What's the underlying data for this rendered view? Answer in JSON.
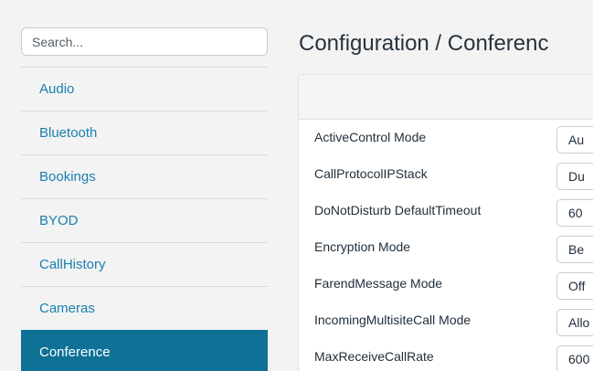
{
  "search": {
    "placeholder": "Search..."
  },
  "sidebar": {
    "items": [
      {
        "label": "Audio"
      },
      {
        "label": "Bluetooth"
      },
      {
        "label": "Bookings"
      },
      {
        "label": "BYOD"
      },
      {
        "label": "CallHistory"
      },
      {
        "label": "Cameras"
      },
      {
        "label": "Conference",
        "active": true
      }
    ]
  },
  "page": {
    "title": "Configuration / Conferenc"
  },
  "settings": [
    {
      "label": "ActiveControl Mode",
      "value": "Au"
    },
    {
      "label": "CallProtocolIPStack",
      "value": "Du"
    },
    {
      "label": "DoNotDisturb DefaultTimeout",
      "value": "60"
    },
    {
      "label": "Encryption Mode",
      "value": "Be"
    },
    {
      "label": "FarendMessage Mode",
      "value": "Off"
    },
    {
      "label": "IncomingMultisiteCall Mode",
      "value": "Allo"
    },
    {
      "label": "MaxReceiveCallRate",
      "value": "600"
    }
  ],
  "colors": {
    "accent": "#0f7196",
    "link": "#1a7fb0"
  }
}
